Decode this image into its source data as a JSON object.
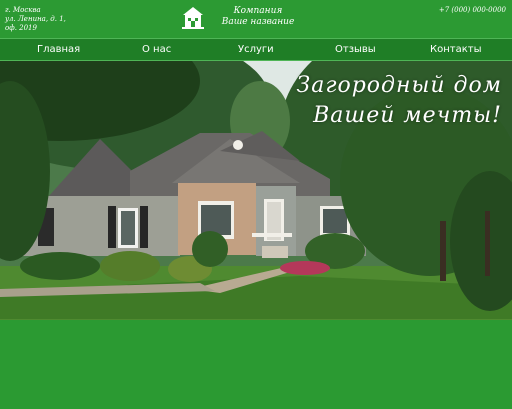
{
  "header": {
    "address_lines": [
      "г. Москва",
      "ул. Ленина, д. 1,",
      "оф. 2019"
    ],
    "company_lines": [
      "Компания",
      "Ваше название"
    ],
    "phone": "+7 (000) 000-0000",
    "logo_icon": "house-icon"
  },
  "nav": {
    "items": [
      {
        "label": "Главная"
      },
      {
        "label": "О нас"
      },
      {
        "label": "Услуги"
      },
      {
        "label": "Отзывы"
      },
      {
        "label": "Контакты"
      }
    ]
  },
  "hero": {
    "slogan_lines": [
      "Загородный дом",
      "Вашей мечты!"
    ]
  },
  "colors": {
    "brand_green": "#2b9a32",
    "nav_green": "#1f7e26",
    "text": "#ffffff"
  }
}
